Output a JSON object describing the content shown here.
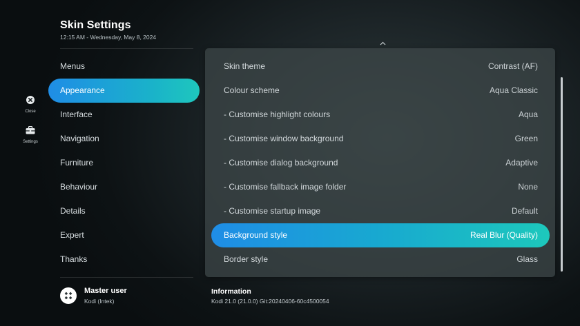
{
  "header": {
    "title": "Skin Settings",
    "datetime": "12:15 AM - Wednesday, May 8, 2024"
  },
  "side_buttons": [
    {
      "label": "Close",
      "icon": "close-icon"
    },
    {
      "label": "Settings",
      "icon": "toolbox-icon"
    }
  ],
  "menu": {
    "active_index": 1,
    "items": [
      "Menus",
      "Appearance",
      "Interface",
      "Navigation",
      "Furniture",
      "Behaviour",
      "Details",
      "Expert",
      "Thanks"
    ]
  },
  "settings": {
    "selected_index": 7,
    "scroll_up_icon": "chevron-up-icon",
    "rows": [
      {
        "label": "Skin theme",
        "value": "Contrast (AF)"
      },
      {
        "label": "Colour scheme",
        "value": "Aqua Classic"
      },
      {
        "label": " - Customise highlight colours",
        "value": "Aqua"
      },
      {
        "label": " - Customise window background",
        "value": "Green"
      },
      {
        "label": " - Customise dialog background",
        "value": "Adaptive"
      },
      {
        "label": " - Customise fallback image folder",
        "value": "None"
      },
      {
        "label": " - Customise startup image",
        "value": "Default"
      },
      {
        "label": "Background style",
        "value": "Real Blur (Quality)"
      },
      {
        "label": "Border style",
        "value": "Glass"
      }
    ]
  },
  "user": {
    "name": "Master user",
    "profile": "Kodi (Intek)",
    "icon": "kodi-logo-icon"
  },
  "info": {
    "title": "Information",
    "text": "Kodi 21.0 (21.0.0) Git:20240406-60c4500054"
  },
  "colors": {
    "accent_start": "#1f8de6",
    "accent_end": "#1ec7bd",
    "panel": "#3e484a"
  }
}
